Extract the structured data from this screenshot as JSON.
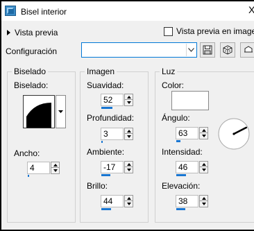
{
  "window": {
    "title": "Bisel interior",
    "close_glyph": "X",
    "icon": "bevel-app-icon",
    "accent_color": "#0078d7",
    "slider_color": "#1976d2"
  },
  "preview": {
    "toggle_label": "Vista previa",
    "checkbox_label": "Vista previa en imagen",
    "checked": false
  },
  "config": {
    "label": "Configuración",
    "value": "",
    "buttons": [
      "save-icon",
      "random-dice-icon",
      "reset-icon"
    ]
  },
  "biselado": {
    "group_label": "Biselado",
    "bevel_label": "Biselado:",
    "ancho": {
      "label": "Ancho:",
      "value": "4",
      "level": 0.04
    }
  },
  "imagen": {
    "group_label": "Imagen",
    "suavidad": {
      "label": "Suavidad:",
      "value": "52",
      "level": 0.52
    },
    "profundidad": {
      "label": "Profundidad:",
      "value": "3",
      "level": 0.03
    },
    "ambiente": {
      "label": "Ambiente:",
      "value": "-17",
      "level": 0.42
    },
    "brillo": {
      "label": "Brillo:",
      "value": "44",
      "level": 0.44
    }
  },
  "luz": {
    "group_label": "Luz",
    "color_label": "Color:",
    "color_value": "#ffffff",
    "angulo": {
      "label": "Ángulo:",
      "value": "63",
      "level": 0.18
    },
    "intensidad": {
      "label": "Intensidad:",
      "value": "46",
      "level": 0.46
    },
    "elevacion": {
      "label": "Elevación:",
      "value": "38",
      "level": 0.42
    }
  }
}
